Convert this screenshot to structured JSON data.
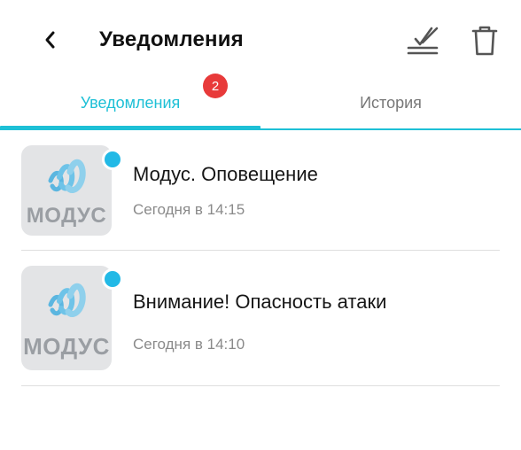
{
  "header": {
    "title": "Уведомления",
    "back_icon": "chevron-left-icon",
    "read_all_icon": "double-check-icon",
    "delete_icon": "trash-icon"
  },
  "tabs": [
    {
      "label": "Уведомления",
      "active": true,
      "badge": "2"
    },
    {
      "label": "История",
      "active": false
    }
  ],
  "notifications": [
    {
      "logo_text": "МОДУС",
      "title": "Модус. Оповещение",
      "time": "Сегодня в 14:15",
      "unread": true
    },
    {
      "logo_text": "МОДУС",
      "title": "Внимание! Опасность атаки",
      "time": "Сегодня в 14:10",
      "unread": true
    }
  ],
  "colors": {
    "accent": "#1ec0d6",
    "badge": "#e83a3a",
    "unread_dot": "#22b9e6",
    "logo_blue": "#5bb6e0"
  }
}
